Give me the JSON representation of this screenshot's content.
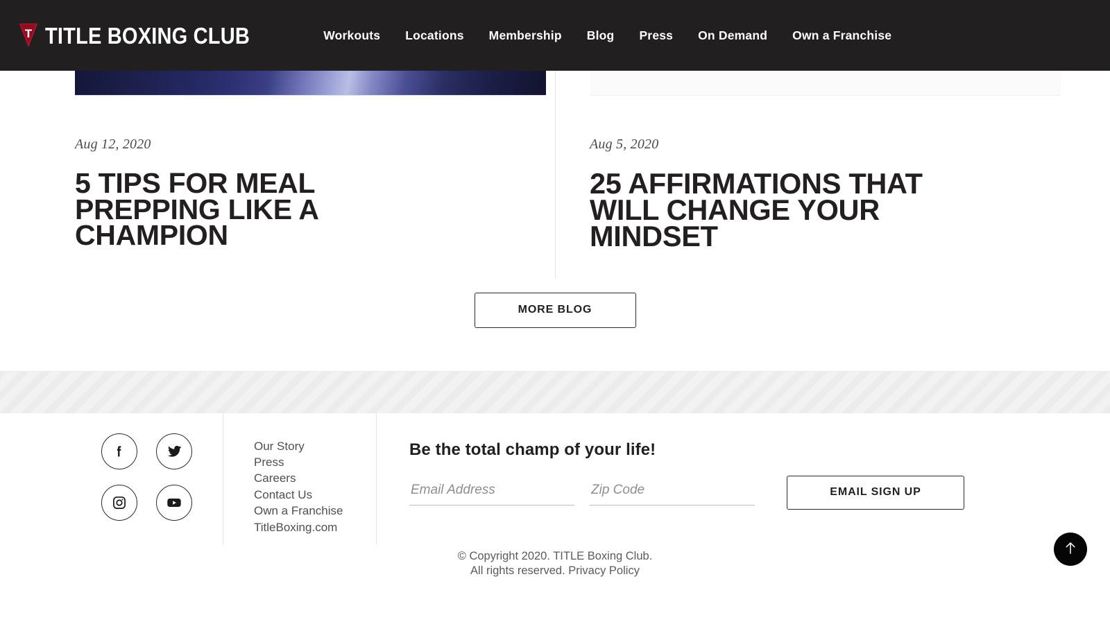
{
  "header": {
    "brand": {
      "mark_letter": "T",
      "name": "TITLE BOXING CLUB"
    },
    "nav_items": [
      {
        "label": "Workouts"
      },
      {
        "label": "Locations"
      },
      {
        "label": "Membership"
      },
      {
        "label": "Blog"
      },
      {
        "label": "Press"
      },
      {
        "label": "On Demand"
      },
      {
        "label": "Own a Franchise"
      }
    ]
  },
  "blog": {
    "posts": [
      {
        "date": "Aug 12, 2020",
        "title": "5 Tips for Meal Prepping Like a Champion"
      },
      {
        "date": "Aug 5, 2020",
        "title": "25 Affirmations That Will Change Your Mindset"
      }
    ],
    "more_button": "MORE BLOG"
  },
  "footer": {
    "social": [
      {
        "name": "facebook",
        "label": "Facebook"
      },
      {
        "name": "twitter",
        "label": "Twitter"
      },
      {
        "name": "instagram",
        "label": "Instagram"
      },
      {
        "name": "youtube",
        "label": "YouTube"
      }
    ],
    "links": [
      {
        "label": "Our Story"
      },
      {
        "label": "Press"
      },
      {
        "label": "Careers"
      },
      {
        "label": "Contact Us"
      },
      {
        "label": "Own a Franchise"
      },
      {
        "label": "TitleBoxing.com"
      }
    ],
    "signup": {
      "heading": "Be the total champ of your life!",
      "email_placeholder": "Email Address",
      "email_value": "",
      "zip_placeholder": "Zip Code",
      "zip_value": "",
      "button": "EMAIL SIGN UP"
    },
    "copyright_line1": "© Copyright 2020. TITLE Boxing Club.",
    "copyright_line2_prefix": "All rights reserved. ",
    "privacy_policy": "Privacy Policy",
    "back_to_top_icon": "arrow-up-icon"
  },
  "colors": {
    "header_bg": "#221f20",
    "brand_red": "#c8102e",
    "text_dark": "#231f20",
    "band_bg": "#f0f0f0"
  }
}
